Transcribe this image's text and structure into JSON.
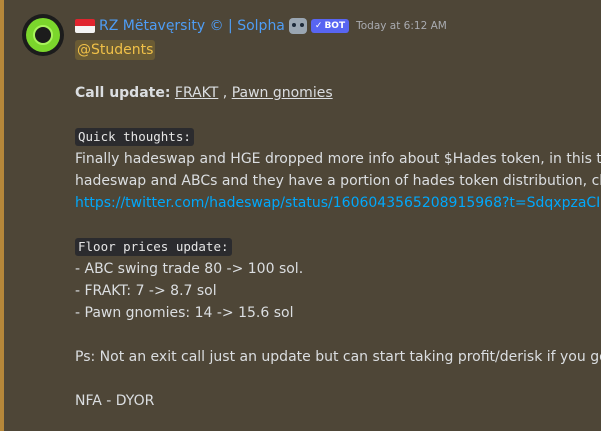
{
  "message": {
    "author": "RZ Mëtavęrsity © | Solpha",
    "bot_badge": "BOT",
    "bot_check": "✓",
    "timestamp": "Today at 6:12 AM",
    "mention": "@Students",
    "call_update_label": "Call update:",
    "call_update_link1": "FRAKT",
    "call_update_sep": " , ",
    "call_update_link2": "Pawn gnomies",
    "quick_thoughts_label": "Quick thoughts:",
    "quick_thoughts_line1": "Finally hadeswap and HGE dropped more info about $Hades token, in this twe",
    "quick_thoughts_line2": "hadeswap and ABCs and they have a portion of hades token distribution, chec",
    "tweet_link": "https://twitter.com/hadeswap/status/1606043565208915968?t=SdqxpzaCIM",
    "floor_label": "Floor prices update:",
    "floor_items": [
      "- ABC swing trade 80 -> 100 sol.",
      "- FRAKT: 7 -> 8.7 sol",
      "- Pawn gnomies: 14 -> 15.6 sol"
    ],
    "ps_line": "Ps: Not an exit call just an update but can start taking profit/derisk if you got r",
    "footer": "NFA - DYOR"
  },
  "colors": {
    "highlight_bg": "#4e4637",
    "accent_bar": "#b5873a",
    "username": "#4e9df5",
    "link": "#00a8fc",
    "mention_text": "#f0c048",
    "bot_badge": "#5865f2"
  },
  "icons": [
    "avatar-logo",
    "indonesia-flag-icon",
    "robot-icon",
    "checkmark-icon"
  ]
}
